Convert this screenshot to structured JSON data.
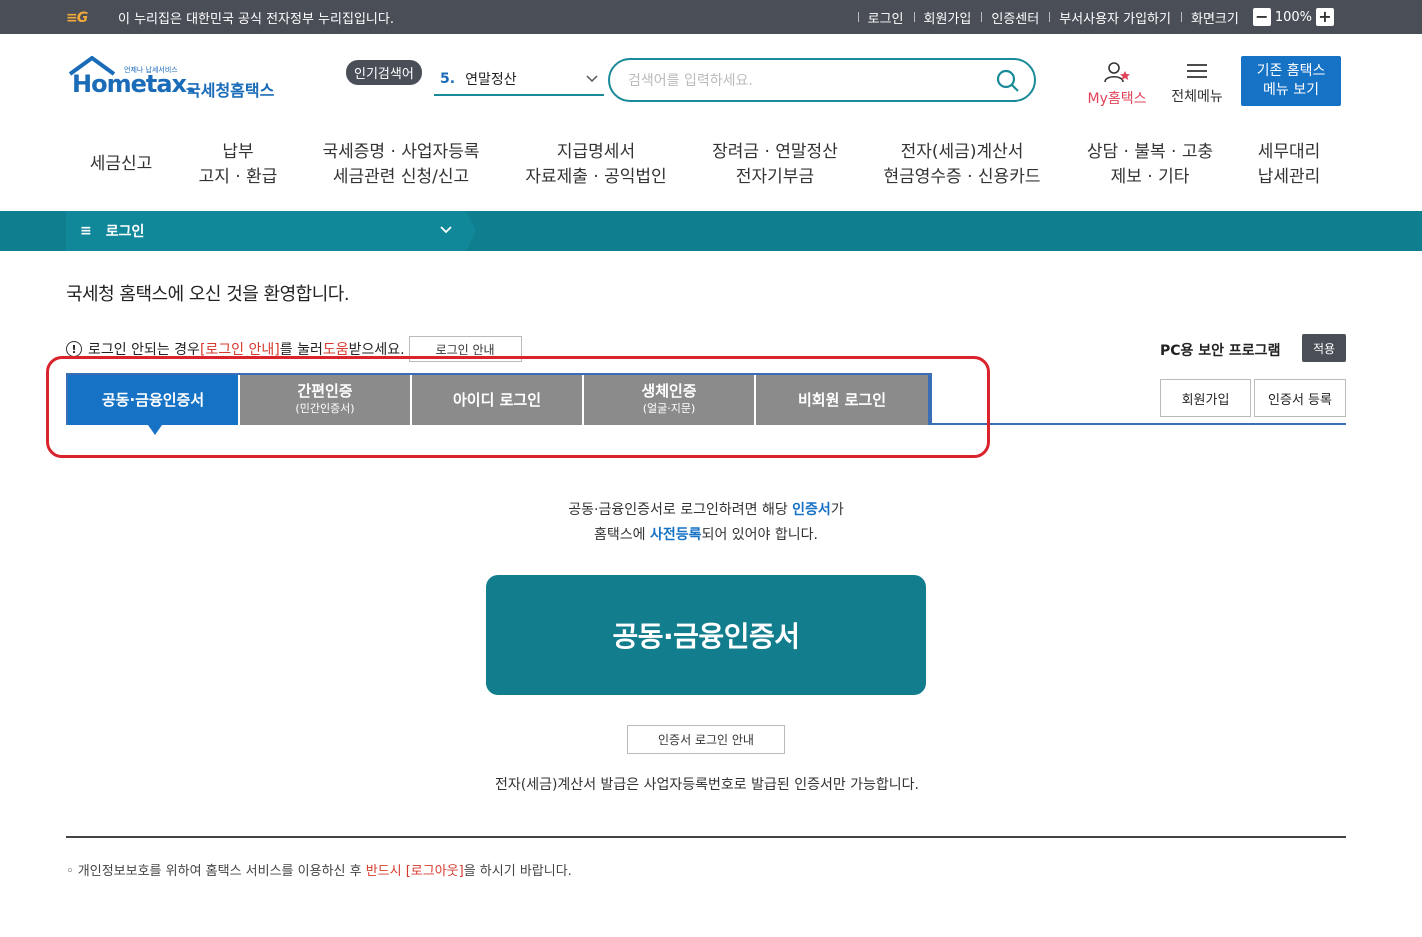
{
  "util": {
    "notice": "이 누리집은 대한민국 공식 전자정부 누리집입니다.",
    "links": [
      "로그인",
      "회원가입",
      "인증센터",
      "부서사용자 가입하기",
      "화면크기"
    ],
    "zoom_minus": "−",
    "zoom_value": "100%",
    "zoom_plus": "+"
  },
  "logo": {
    "small": "언제나 납세서비스",
    "home": "Home",
    "tax": "tax.",
    "kr": "국세청홈택스"
  },
  "popular": {
    "badge": "인기검색어",
    "rank": "5.",
    "term": "연말정산"
  },
  "search": {
    "placeholder": "검색어를 입력하세요."
  },
  "header_right": {
    "myhome": "My홈택스",
    "allmenu": "전체메뉴",
    "oldmenu_line1": "기존 홈택스",
    "oldmenu_line2": "메뉴 보기"
  },
  "gnb": [
    {
      "l1": "세금신고",
      "l2": ""
    },
    {
      "l1": "납부",
      "l2": "고지 · 환급"
    },
    {
      "l1": "국세증명 · 사업자등록",
      "l2": "세금관련 신청/신고"
    },
    {
      "l1": "지급명세서",
      "l2": "자료제출 · 공익법인"
    },
    {
      "l1": "장려금 · 연말정산",
      "l2": "전자기부금"
    },
    {
      "l1": "전자(세금)계산서",
      "l2": "현금영수증 · 신용카드"
    },
    {
      "l1": "상담 · 불복 · 고충",
      "l2": "제보 · 기타"
    },
    {
      "l1": "세무대리",
      "l2": "납세관리"
    }
  ],
  "location": {
    "current": "로그인"
  },
  "welcome": "국세청 홈택스에 오신 것을 환영합니다.",
  "help": {
    "pre": "로그인 안되는 경우 ",
    "link": "[로그인 안내]",
    "mid": "를 눌러 ",
    "red2": "도움",
    "post": "받으세요.",
    "button": "로그인 안내"
  },
  "pc_security": {
    "label": "PC용 보안 프로그램",
    "button": "적용"
  },
  "tabs": [
    {
      "label": "공동·금융인증서",
      "sub": ""
    },
    {
      "label": "간편인증",
      "sub": "(민간인증서)"
    },
    {
      "label": "아이디 로그인",
      "sub": ""
    },
    {
      "label": "생체인증",
      "sub": "(얼굴·지문)"
    },
    {
      "label": "비회원 로그인",
      "sub": ""
    }
  ],
  "side_buttons": {
    "join": "회원가입",
    "cert_register": "인증서 등록"
  },
  "desc": {
    "l1_pre": "공동·금융인증서로 로그인하려면 해당 ",
    "l1_blue": "인증서",
    "l1_post": "가",
    "l2_pre": "홈택스에 ",
    "l2_blue": "사전등록",
    "l2_post": "되어 있어야 합니다."
  },
  "big_button": "공동·금융인증서",
  "cert_guide": "인증서 로그인 안내",
  "tax_note": "전자(세금)계산서 발급은 사업자등록번호로 발급된 인증서만 가능합니다.",
  "privacy": {
    "pre": "◦ 개인정보보호를 위하여 홈택스 서비스를 이용하신 후 ",
    "red": "반드시 [로그아웃]",
    "post": "을 하시기 바랍니다."
  },
  "colors": {
    "teal": "#0f7f90",
    "blue": "#1672c5",
    "red_highlight": "#d9232d",
    "dark_bar": "#4a4e57"
  }
}
